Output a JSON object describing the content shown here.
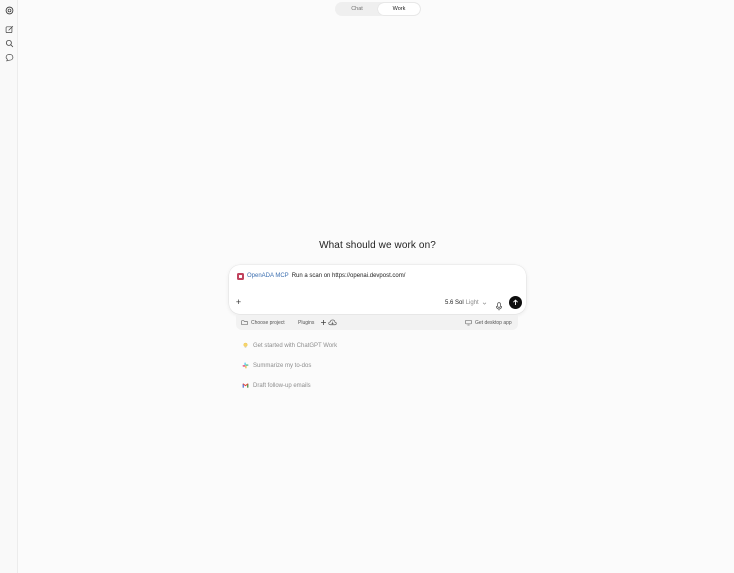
{
  "sidebar": {
    "icons": [
      "openai-logo-icon",
      "new-chat-icon",
      "search-icon",
      "chat-bubble-icon"
    ]
  },
  "mode_toggle": {
    "options": [
      "Chat",
      "Work"
    ],
    "selected": "Work"
  },
  "main": {
    "heading": "What should we work on?"
  },
  "composer": {
    "plugin_name": "OpenADA MCP",
    "prompt_text": "Run a scan on https://openai.devpost.com/",
    "model_name": "5.6 Sol",
    "model_level": "Light",
    "plugin_color": "#c0435e",
    "send_color": "#0d0d0d"
  },
  "subbar": {
    "choose_project": "Choose project",
    "plugins": "Plugins",
    "get_desktop_app": "Get desktop app"
  },
  "suggestions": [
    {
      "label": "Get started with ChatGPT Work",
      "icon": "lightbulb-icon"
    },
    {
      "label": "Summarize my to-dos",
      "icon": "slack-icon"
    },
    {
      "label": "Draft follow-up emails",
      "icon": "gmail-icon"
    }
  ]
}
